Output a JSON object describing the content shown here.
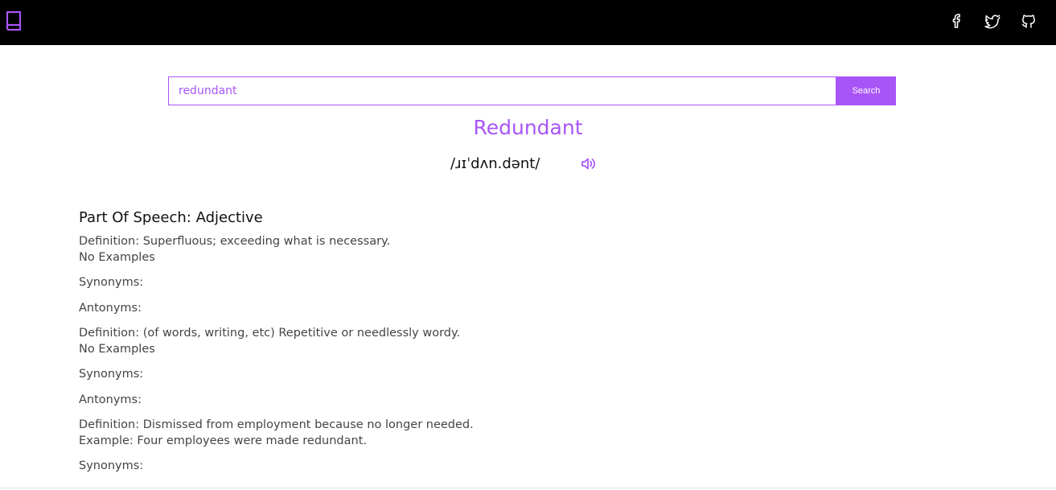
{
  "header": {
    "logo_icon": "book-icon",
    "social": [
      {
        "icon": "facebook-icon"
      },
      {
        "icon": "twitter-icon"
      },
      {
        "icon": "github-icon"
      }
    ],
    "accent_color": "#a855f7"
  },
  "search": {
    "value": "redundant",
    "button_label": "Search"
  },
  "word": {
    "title": "Redundant",
    "phonetic": "/ɹɪˈdʌn.dənt/",
    "audio_icon": "speaker-icon"
  },
  "meanings": [
    {
      "part_of_speech": "Part Of Speech: Adjective",
      "definitions": [
        {
          "definition": "Definition: Superfluous; exceeding what is necessary.",
          "example": "No Examples",
          "synonyms": "Synonyms:",
          "antonyms": "Antonyms:"
        },
        {
          "definition": "Definition: (of words, writing, etc) Repetitive or needlessly wordy.",
          "example": "No Examples",
          "synonyms": "Synonyms:",
          "antonyms": "Antonyms:"
        },
        {
          "definition": "Definition: Dismissed from employment because no longer needed.",
          "example": "Example: Four employees were made redundant.",
          "synonyms": "Synonyms:"
        }
      ]
    }
  ]
}
